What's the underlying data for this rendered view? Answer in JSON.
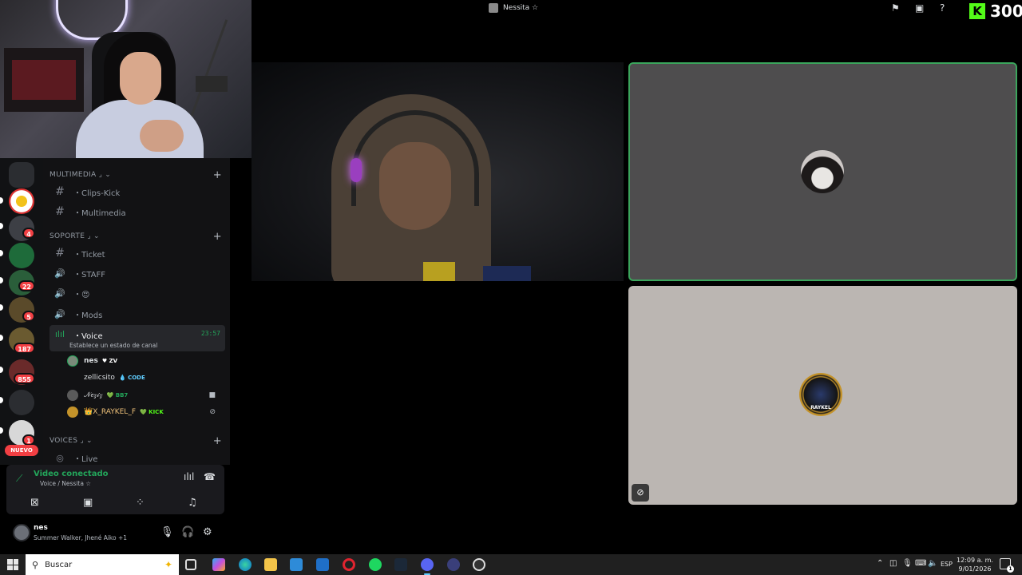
{
  "top_bar": {
    "title": "Nessita ☆",
    "kick_count": "300"
  },
  "channels": {
    "categories": {
      "multimedia": "MULTIMEDIA ⌟ ⌄",
      "soporte": "SOPORTE ⌟ ⌄",
      "voices": "VOICES ⌟ ⌄"
    },
    "items": {
      "clips_kick": "・Clips-Kick",
      "multimedia": "・Multimedia",
      "ticket": "・Ticket",
      "staff": "・STAFF",
      "emoji": "・😍",
      "mods": "・Mods",
      "voice": "・Voice",
      "live": "・Live"
    },
    "voice_timer": "23:57",
    "voice_status": "Establece un estado de canal",
    "members": [
      {
        "name": "nes",
        "tag": "♥ ZV",
        "tag_color": "#ffffff"
      },
      {
        "name": "zellicsito",
        "tag": "💧 CODE",
        "tag_color": "#60cdff"
      },
      {
        "name": "𝒩𝑒𝓏𝒾𝓏",
        "tag": "💚 BB7",
        "tag_color": "#23a55a"
      },
      {
        "name": "👑X_RAYKEL_F",
        "tag": "💚 KICK",
        "tag_color": "#53fc18"
      }
    ]
  },
  "rail": {
    "badges": [
      "4",
      "22",
      "5",
      "187",
      "855",
      "1"
    ],
    "new_label": "NUEVO"
  },
  "voice_panel": {
    "title": "Video conectado",
    "subtitle": "Voice / Nessita ☆"
  },
  "user_panel": {
    "name": "nes",
    "activity": "Summer Walker, Jhené Aiko +1"
  },
  "tiles": {
    "raykel_text": "RAYKEL"
  },
  "taskbar": {
    "search_placeholder": "Buscar",
    "language": "ESP",
    "time": "12:09 a. m.",
    "date": "9/01/2026",
    "notif_count": "1"
  },
  "colors": {
    "accent_green": "#23a55a",
    "kick_green": "#53fc18",
    "badge_red": "#f23f43"
  }
}
